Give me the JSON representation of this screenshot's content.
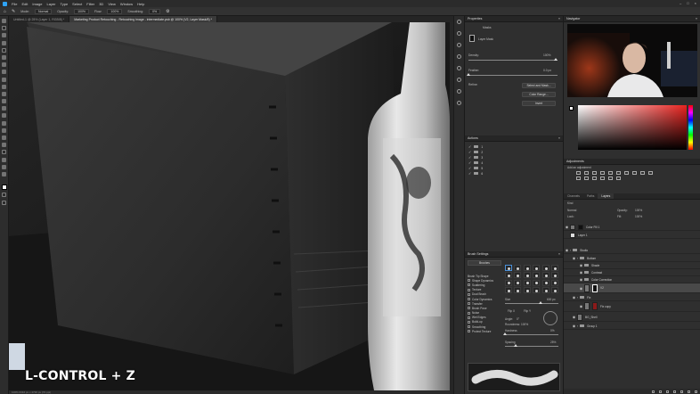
{
  "menubar": {
    "items": [
      "File",
      "Edit",
      "Image",
      "Layer",
      "Type",
      "Select",
      "Filter",
      "3D",
      "View",
      "Window",
      "Help"
    ]
  },
  "options": {
    "mode_label": "Mode:",
    "mode_value": "Normal",
    "opacity_label": "Opacity:",
    "opacity_value": "100%",
    "flow_label": "Flow:",
    "flow_value": "100%",
    "smoothing_label": "Smoothing:",
    "smoothing_value": "0%"
  },
  "tabs": [
    {
      "label": "Untitled-1 @ 25% (Layer 1, RGB/8) *"
    },
    {
      "label": "Marketing Product Retouching - Retouching image - intermediate.psb @ 100% (V2, Layer Mask/8) *"
    }
  ],
  "status": {
    "left": "100%    6316 px x 4736 px (72 ppi)"
  },
  "overlay": {
    "shortcut_text": "L-CONTROL + Z"
  },
  "properties": {
    "title": "Properties",
    "kind": "Masks",
    "layer_mask": "Layer Mask",
    "density_label": "Density:",
    "density_value": "100%",
    "feather_label": "Feather:",
    "feather_value": "0.0 px",
    "refine_label": "Refine:",
    "select_mask_btn": "Select and Mask...",
    "color_range_btn": "Color Range...",
    "invert_btn": "Invert"
  },
  "actions": {
    "title": "Actions",
    "rows": [
      "1",
      "2",
      "3",
      "4",
      "5",
      "6"
    ]
  },
  "brush_settings": {
    "title": "Brush Settings",
    "brushes_btn": "Brushes",
    "options": [
      "Brush Tip Shape",
      "Shape Dynamics",
      "Scattering",
      "Texture",
      "Dual Brush",
      "Color Dynamics",
      "Transfer",
      "Brush Pose",
      "Noise",
      "Wet Edges",
      "Build-up",
      "Smoothing",
      "Protect Texture"
    ],
    "size_label": "Size",
    "size_value": "600 px",
    "flip_x": "Flip X",
    "flip_y": "Flip Y",
    "angle_label": "Angle:",
    "angle_value": "0°",
    "roundness_label": "Roundness:",
    "roundness_value": "100%",
    "hardness_label": "Hardness",
    "hardness_value": "0%",
    "spacing_label": "Spacing",
    "spacing_value": "25%"
  },
  "navigator": {
    "title": "Navigator"
  },
  "adjustments": {
    "title": "Adjustments",
    "subtitle": "Add an adjustment"
  },
  "layers": {
    "tabs": [
      "Channels",
      "Paths",
      "Layers"
    ],
    "kind_label": "Kind",
    "blend_mode": "Normal",
    "opacity_label": "Opacity:",
    "opacity_value": "100%",
    "lock_label": "Lock:",
    "fill_label": "Fill:",
    "fill_value": "100%",
    "rows": [
      {
        "name": "Color Fill 1"
      },
      {
        "name": "Layer 1"
      },
      {
        "name": "Studio"
      },
      {
        "name": "Bottom"
      },
      {
        "name": "Shade"
      },
      {
        "name": "Contrast"
      },
      {
        "name": "Color Correction"
      },
      {
        "name": "V2"
      },
      {
        "name": "Fix"
      },
      {
        "name": "Fix copy"
      },
      {
        "name": "BG_Shell"
      },
      {
        "name": "Group 1"
      }
    ]
  },
  "colors": {
    "accent": "#2fa3f7",
    "picker_hue": "#e8231f"
  }
}
